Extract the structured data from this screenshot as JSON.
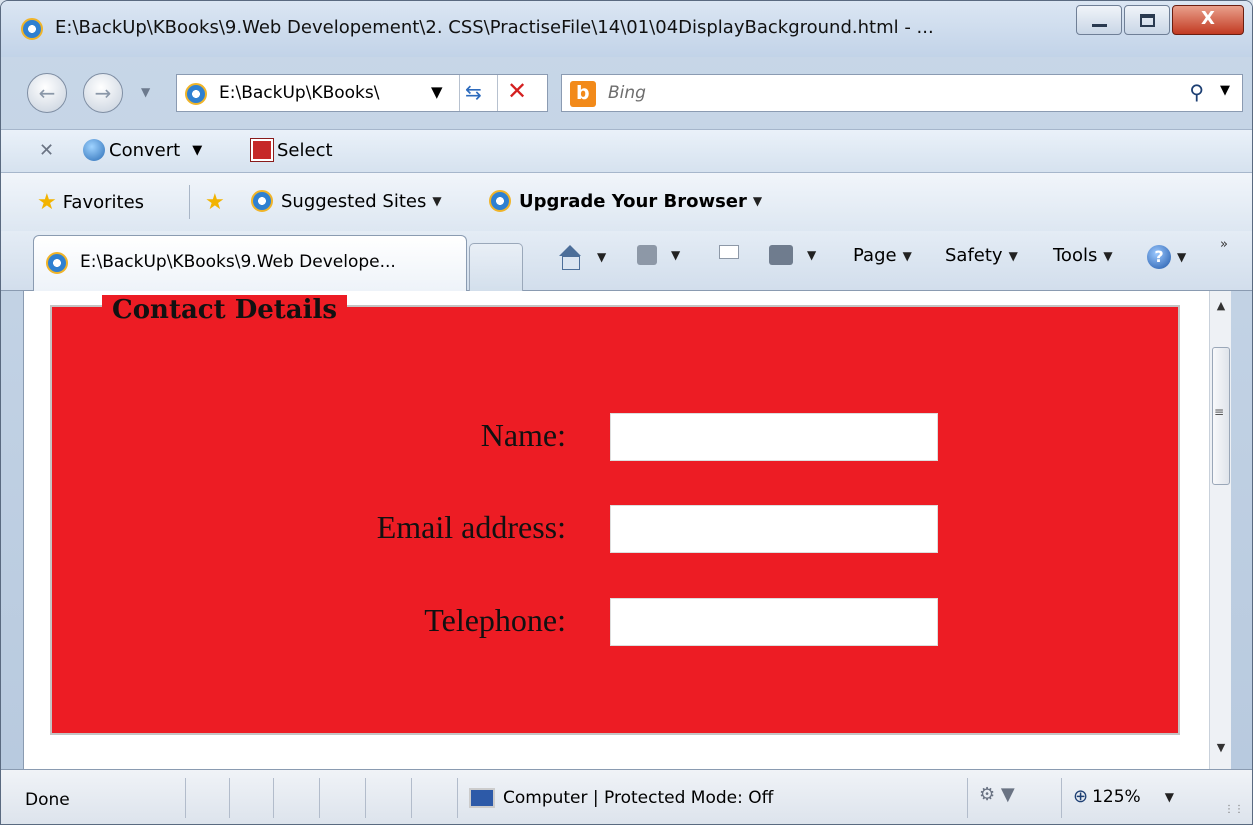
{
  "window": {
    "title": "E:\\BackUp\\KBooks\\9.Web Developement\\2. CSS\\PractiseFile\\14\\01\\04DisplayBackground.html - ...",
    "close_label": "X"
  },
  "address_bar": {
    "url": "E:\\BackUp\\KBooks\\",
    "search_placeholder": "Bing",
    "bing_logo": "b"
  },
  "command_bar": {
    "convert_label": "Convert",
    "select_label": "Select"
  },
  "favorites_bar": {
    "favorites_label": "Favorites",
    "suggested_sites_label": "Suggested Sites",
    "upgrade_label": "Upgrade Your Browser"
  },
  "tab": {
    "title": "E:\\BackUp\\KBooks\\9.Web Develope..."
  },
  "tools": {
    "page_label": "Page",
    "safety_label": "Safety",
    "tools_label": "Tools",
    "help_glyph": "?"
  },
  "page": {
    "legend": "Contact Details",
    "fields": [
      {
        "label": "Name:"
      },
      {
        "label": "Email address:"
      },
      {
        "label": "Telephone:"
      }
    ],
    "background_color": "#ed1c24"
  },
  "status_bar": {
    "status": "Done",
    "zone": "Computer | Protected Mode: Off",
    "zoom": "125%"
  },
  "icons": [
    "ie-icon",
    "back-icon",
    "forward-icon",
    "refresh-icon",
    "stop-icon",
    "search-icon",
    "star-icon",
    "home-icon",
    "rss-icon",
    "mail-icon",
    "print-icon",
    "help-icon",
    "computer-icon",
    "zoom-icon"
  ]
}
